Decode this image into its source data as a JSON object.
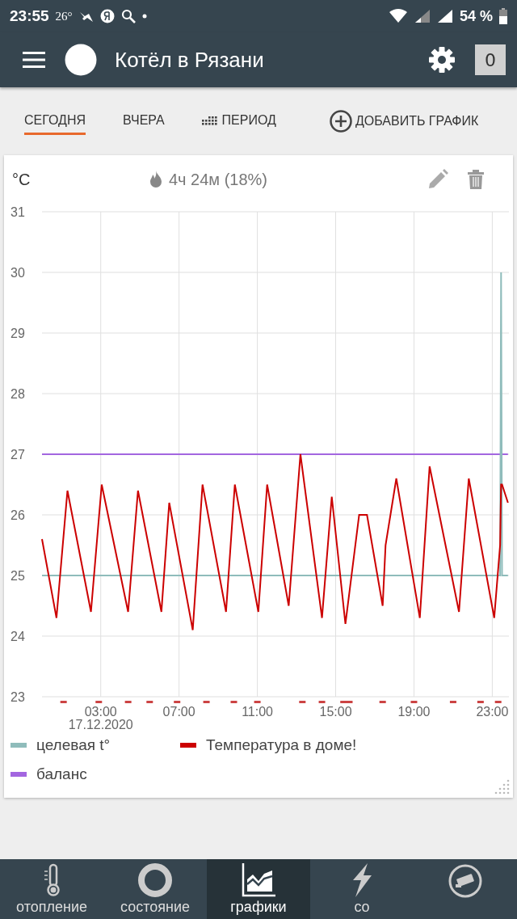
{
  "status_bar": {
    "time": "23:55",
    "temperature": "26°",
    "battery": "54 %"
  },
  "app_bar": {
    "title": "Котёл в Рязани",
    "counter": "0"
  },
  "period_tabs": [
    {
      "label": "СЕГОДНЯ",
      "selected": true,
      "kind": "plain"
    },
    {
      "label": "ВЧЕРА",
      "selected": false,
      "kind": "plain"
    },
    {
      "label": "ПЕРИОД",
      "selected": false,
      "kind": "calendar"
    }
  ],
  "add_chart_button": "ДОБАВИТЬ ГРАФИК",
  "chart_card": {
    "unit": "°C",
    "burner_time": "4ч 24м (18%)",
    "date_label": "17.12.2020",
    "chart_data": {
      "type": "line",
      "x": [
        0,
        0.74,
        1.3,
        2.5,
        3.05,
        4.4,
        4.9,
        6.1,
        6.5,
        7.7,
        8.2,
        9.4,
        9.85,
        11.05,
        11.5,
        12.6,
        13.2,
        14.3,
        14.8,
        15.5,
        16.2,
        16.6,
        17.4,
        17.55,
        18.1,
        19.3,
        19.8,
        21.3,
        21.8,
        23.1,
        23.4,
        23.45,
        23.5,
        23.8
      ],
      "series": [
        {
          "name": "целевая t°",
          "color": "#8fbcbb",
          "values": [
            25,
            25,
            25,
            25,
            25,
            25,
            25,
            25,
            25,
            25,
            25,
            25,
            25,
            25,
            25,
            25,
            25,
            25,
            25,
            25,
            25,
            25,
            25,
            25,
            25,
            25,
            25,
            25,
            25,
            25,
            25,
            30,
            25,
            25
          ]
        },
        {
          "name": "Температура в доме!",
          "color": "#cc0000",
          "values": [
            25.6,
            24.3,
            26.4,
            24.4,
            26.5,
            24.4,
            26.4,
            24.4,
            26.2,
            24.1,
            26.5,
            24.4,
            26.5,
            24.4,
            26.5,
            24.5,
            27.0,
            24.3,
            26.3,
            24.2,
            26.0,
            26.0,
            24.5,
            25.5,
            26.6,
            24.3,
            26.8,
            24.4,
            26.6,
            24.3,
            25.5,
            26.5,
            26.5,
            26.2
          ]
        },
        {
          "name": "баланс",
          "color": "#a366e0",
          "values": [
            27,
            27,
            27,
            27,
            27,
            27,
            27,
            27,
            27,
            27,
            27,
            27,
            27,
            27,
            27,
            27,
            27,
            27,
            27,
            27,
            27,
            27,
            27,
            27,
            27,
            27,
            27,
            27,
            27,
            27,
            27,
            27,
            27,
            27
          ]
        }
      ],
      "xlim": [
        0,
        23.85
      ],
      "ylim": [
        23,
        31
      ],
      "xticks": [
        {
          "value": 3,
          "label": "03:00"
        },
        {
          "value": 7,
          "label": "07:00"
        },
        {
          "value": 11,
          "label": "11:00"
        },
        {
          "value": 15,
          "label": "15:00"
        },
        {
          "value": 19,
          "label": "19:00"
        },
        {
          "value": 23,
          "label": "23:00"
        }
      ],
      "yticks": [
        23,
        24,
        25,
        26,
        27,
        28,
        29,
        30,
        31
      ]
    }
  },
  "bottom_nav": [
    {
      "label": "отопление",
      "selected": false,
      "kind": "thermometer"
    },
    {
      "label": "состояние",
      "selected": false,
      "kind": "ring"
    },
    {
      "label": "графики",
      "selected": true,
      "kind": "chart"
    },
    {
      "label": "со",
      "selected": false,
      "kind": "bolt"
    },
    {
      "selected": false,
      "kind": "camera"
    }
  ]
}
